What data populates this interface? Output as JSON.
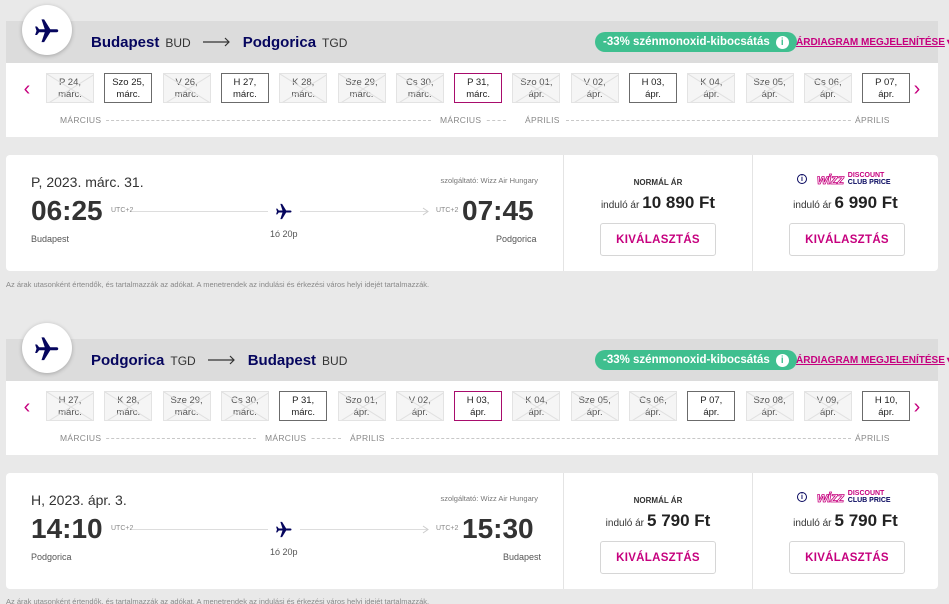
{
  "outbound": {
    "origin": "Budapest",
    "origin_code": "BUD",
    "destination": "Podgorica",
    "destination_code": "TGD",
    "co2_label": "-33% szénmonoxid-kibocsátás",
    "price_chart_link": "ÁRDIAGRAM MEGJELENÍTÉSE",
    "dates": [
      {
        "label": "P 24,\nmárc.",
        "state": "unavailable"
      },
      {
        "label": "Szo 25,\nmárc.",
        "state": "available"
      },
      {
        "label": "V 26,\nmárc.",
        "state": "unavailable"
      },
      {
        "label": "H 27,\nmárc.",
        "state": "available"
      },
      {
        "label": "K 28,\nmárc.",
        "state": "unavailable"
      },
      {
        "label": "Sze 29,\nmárc.",
        "state": "unavailable"
      },
      {
        "label": "Cs 30,\nmárc.",
        "state": "unavailable"
      },
      {
        "label": "P 31,\nmárc.",
        "state": "selected"
      },
      {
        "label": "Szo 01,\nápr.",
        "state": "unavailable"
      },
      {
        "label": "V 02,\nápr.",
        "state": "unavailable"
      },
      {
        "label": "H 03,\nápr.",
        "state": "available"
      },
      {
        "label": "K 04,\nápr.",
        "state": "unavailable"
      },
      {
        "label": "Sze 05,\nápr.",
        "state": "unavailable"
      },
      {
        "label": "Cs 06,\nápr.",
        "state": "unavailable"
      },
      {
        "label": "P 07,\nápr.",
        "state": "available"
      }
    ],
    "months": [
      "MÁRCIUS",
      "MÁRCIUS",
      "ÁPRILIS",
      "ÁPRILIS"
    ],
    "flight": {
      "date": "P, 2023. márc. 31.",
      "operator": "szolgáltató: Wizz Air Hungary",
      "dep_time": "06:25",
      "dep_utc": "UTC+2",
      "dep_city": "Budapest",
      "arr_time": "07:45",
      "arr_utc": "UTC+2",
      "arr_city": "Podgorica",
      "duration": "1ó 20p",
      "normal_title": "NORMÁL ÁR",
      "from_label": "induló ár",
      "normal_price": "10 890 Ft",
      "club_price": "6 990 Ft",
      "select_label": "KIVÁLASZTÁS"
    }
  },
  "inbound": {
    "origin": "Podgorica",
    "origin_code": "TGD",
    "destination": "Budapest",
    "destination_code": "BUD",
    "co2_label": "-33% szénmonoxid-kibocsátás",
    "price_chart_link": "ÁRDIAGRAM MEGJELENÍTÉSE",
    "dates": [
      {
        "label": "H 27,\nmárc.",
        "state": "unavailable"
      },
      {
        "label": "K 28,\nmárc.",
        "state": "unavailable"
      },
      {
        "label": "Sze 29,\nmárc.",
        "state": "unavailable"
      },
      {
        "label": "Cs 30,\nmárc.",
        "state": "unavailable"
      },
      {
        "label": "P 31,\nmárc.",
        "state": "available"
      },
      {
        "label": "Szo 01,\nápr.",
        "state": "unavailable"
      },
      {
        "label": "V 02,\nápr.",
        "state": "unavailable"
      },
      {
        "label": "H 03,\nápr.",
        "state": "selected"
      },
      {
        "label": "K 04,\nápr.",
        "state": "unavailable"
      },
      {
        "label": "Sze 05,\nápr.",
        "state": "unavailable"
      },
      {
        "label": "Cs 06,\nápr.",
        "state": "unavailable"
      },
      {
        "label": "P 07,\nápr.",
        "state": "available"
      },
      {
        "label": "Szo 08,\nápr.",
        "state": "unavailable"
      },
      {
        "label": "V 09,\nápr.",
        "state": "unavailable"
      },
      {
        "label": "H 10,\nápr.",
        "state": "available"
      }
    ],
    "months": [
      "MÁRCIUS",
      "MÁRCIUS",
      "ÁPRILIS",
      "ÁPRILIS"
    ],
    "flight": {
      "date": "H, 2023. ápr. 3.",
      "operator": "szolgáltató: Wizz Air Hungary",
      "dep_time": "14:10",
      "dep_utc": "UTC+2",
      "dep_city": "Podgorica",
      "arr_time": "15:30",
      "arr_utc": "UTC+2",
      "arr_city": "Budapest",
      "duration": "1ó 20p",
      "normal_title": "NORMÁL ÁR",
      "from_label": "induló ár",
      "normal_price": "5 790 Ft",
      "club_price": "5 790 Ft",
      "select_label": "KIVÁLASZTÁS"
    }
  },
  "club_logo": {
    "brand": "wizz",
    "line1": "DISCOUNT",
    "line2": "CLUB PRICE"
  },
  "disclaimer": "Az árak utasonként értendők, és tartalmazzák az adókat. A menetrendek az indulási és érkezési város helyi idejét tartalmazzák.",
  "colors": {
    "brand_magenta": "#c6007e",
    "navy": "#06065e",
    "co2_green": "#3fbf8f"
  },
  "icons": [
    "plane-icon",
    "arrow-right-icon",
    "info-icon",
    "chevron-left-icon",
    "chevron-right-icon",
    "caret-down-icon"
  ]
}
